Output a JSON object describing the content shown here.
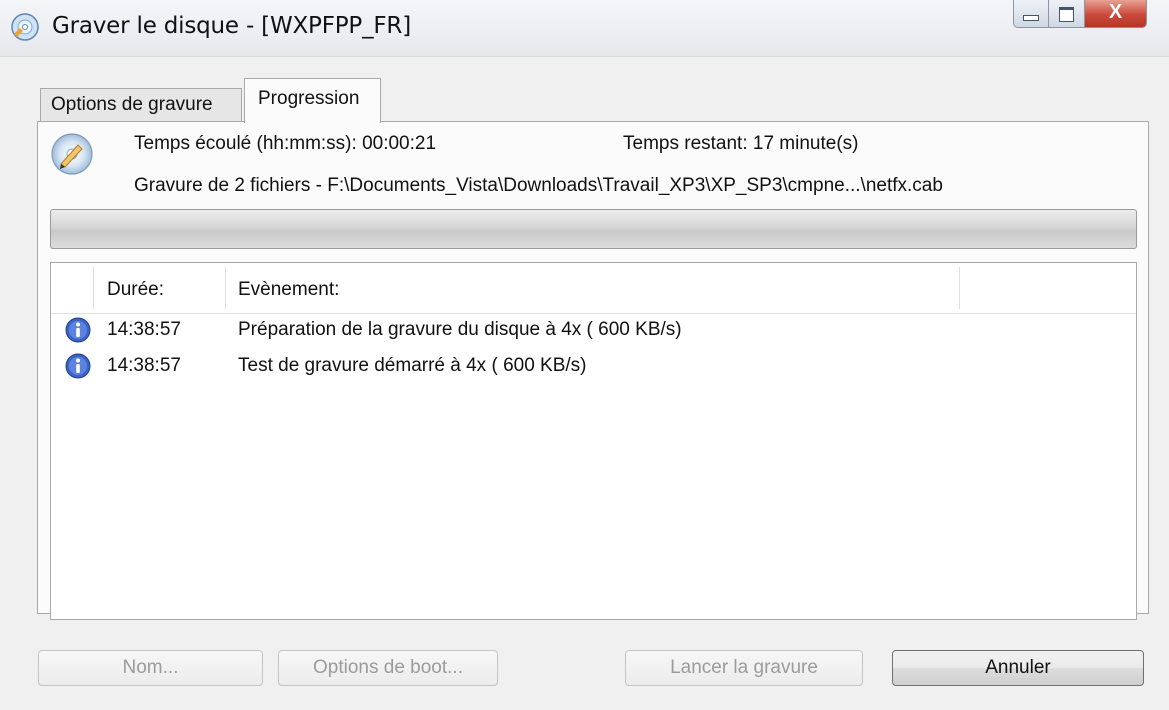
{
  "window": {
    "title": "Graver le disque - [WXPFPP_FR]",
    "close_glyph": "X"
  },
  "tabs": [
    {
      "label": "Options de gravure",
      "active": false
    },
    {
      "label": "Progression",
      "active": true
    }
  ],
  "progress": {
    "elapsed": "Temps écoulé (hh:mm:ss): 00:00:21",
    "remaining": "Temps restant: 17 minute(s)",
    "status": "Gravure de 2 fichiers - F:\\Documents_Vista\\Downloads\\Travail_XP3\\XP_SP3\\cmpne...\\netfx.cab",
    "percent": 0
  },
  "events": {
    "columns": [
      "Durée:",
      "Evènement:"
    ],
    "rows": [
      {
        "icon": "info-icon",
        "time": "14:38:57",
        "event": "Préparation de la gravure du disque à 4x ( 600 KB/s)"
      },
      {
        "icon": "info-icon",
        "time": "14:38:57",
        "event": "Test de gravure démarré à 4x ( 600 KB/s)"
      }
    ]
  },
  "buttons": {
    "name": "Nom...",
    "boot": "Options de boot...",
    "launch": "Lancer la gravure",
    "cancel": "Annuler"
  },
  "icons": {
    "app": "disc-burn-icon",
    "status": "disc-pen-icon",
    "row": "info-icon"
  }
}
